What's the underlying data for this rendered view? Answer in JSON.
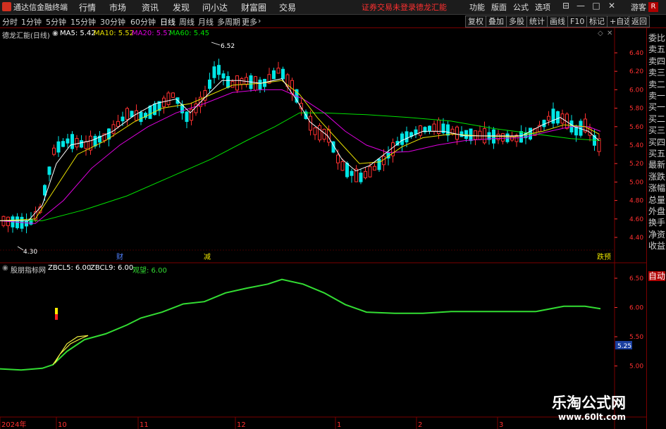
{
  "app": {
    "title": "通达信金融终端",
    "menus": [
      "行情",
      "市场",
      "资讯",
      "发现",
      "问小达",
      "财富圈",
      "交易"
    ],
    "status_text": "证券交易未登录",
    "stock_name_bar": "德龙汇能",
    "right_menus": [
      "功能",
      "版面",
      "公式",
      "选项"
    ],
    "user": "游客"
  },
  "toolbar": {
    "periods": [
      "分时",
      "1分钟",
      "5分钟",
      "15分钟",
      "30分钟",
      "60分钟",
      "日线",
      "周线",
      "月线",
      "多周期",
      "更多"
    ],
    "active_period": "日线",
    "right_buttons": [
      "复权",
      "叠加",
      "多股",
      "统计",
      "画线",
      "F10",
      "标记",
      "+自选",
      "返回"
    ]
  },
  "main_info": {
    "stock": "德龙汇能(日线)",
    "ma5": "MA5: 5.42",
    "ma10": "MA10: 5.52",
    "ma20": "MA20: 5.57",
    "ma60": "MA60: 5.45",
    "high_label": "6.52",
    "low_label": "4.30",
    "y_ticks": [
      "6.40",
      "6.20",
      "6.00",
      "5.80",
      "5.60",
      "5.40",
      "5.20",
      "5.00",
      "4.80",
      "4.60",
      "4.40"
    ],
    "markers": [
      "财",
      "减",
      "跌预"
    ]
  },
  "indicator_info": {
    "name": "股朋指标网",
    "zbcl5": "ZBCL5: 6.00",
    "zbcl9": "ZBCL9: 6.00",
    "guanwang": "观望: 6.00",
    "y_ticks": [
      "6.50",
      "6.00",
      "5.50",
      "5.00"
    ],
    "cursor_value": "5.25"
  },
  "x_axis": [
    "2024年",
    "10",
    "11",
    "12",
    "1",
    "2",
    "3"
  ],
  "right_panel": {
    "items": [
      "委比",
      "卖五",
      "卖四",
      "卖三",
      "卖二",
      "卖一",
      "买一",
      "买二",
      "买三",
      "买四",
      "买五",
      "最新",
      "涨跌",
      "涨幅",
      "总量",
      "外盘",
      "换手",
      "净资",
      "收益"
    ],
    "auto_button": "自动",
    "top_badge": "R"
  },
  "watermark": {
    "line1": "乐淘公式网",
    "line2": "www.60lt.com"
  },
  "colors": {
    "up": "#ff3030",
    "down": "#00e5e5",
    "ma5": "#ffffff",
    "ma10": "#e8e000",
    "ma20": "#e000e0",
    "ma60": "#00e000",
    "indicator": "#33dd33",
    "frame": "#7a0000"
  }
}
